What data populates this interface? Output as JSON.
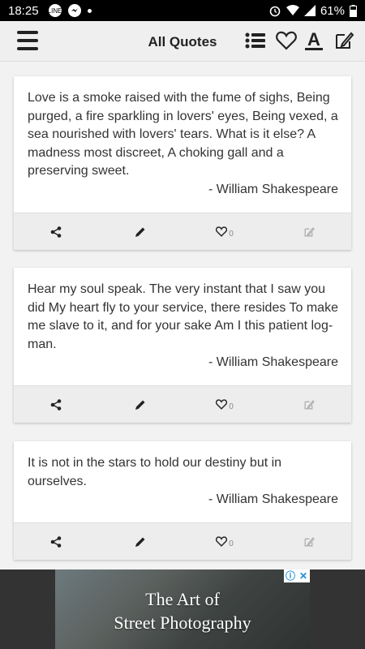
{
  "status_bar": {
    "time": "18:25",
    "battery": "61%"
  },
  "app_bar": {
    "title": "All Quotes",
    "icons": [
      "menu-icon",
      "list-icon",
      "heart-icon",
      "font-icon",
      "edit-note-icon"
    ]
  },
  "quotes": [
    {
      "text": "Love is a smoke raised with the fume of sighs, Being purged, a fire sparkling in lovers' eyes, Being vexed, a sea nourished with lovers' tears. What is it else? A madness most discreet, A choking gall and a preserving sweet.",
      "author": "- William Shakespeare",
      "likes": "0"
    },
    {
      "text": "Hear my soul speak. The very instant that I saw you did My heart fly to your service, there resides To make me slave to it, and for your sake Am I this patient log-man.",
      "author": "- William Shakespeare",
      "likes": "0"
    },
    {
      "text": "It is not in the stars to hold our destiny but in ourselves.",
      "author": "- William Shakespeare",
      "likes": "0"
    }
  ],
  "ad": {
    "line1": "The Art of",
    "line2": "Street Photography"
  },
  "colors": {
    "app_bar_bg": "#efefef",
    "page_bg": "#f2f2f2",
    "card_bg": "#ffffff",
    "action_bar_bg": "#ededed"
  }
}
